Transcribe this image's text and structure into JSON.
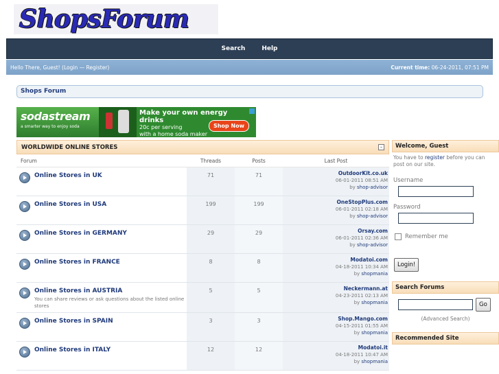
{
  "logo": {
    "text": "ShopsForum"
  },
  "nav": {
    "search": "Search",
    "help": "Help"
  },
  "welcome": {
    "greeting": "Hello There, Guest! (",
    "login": "Login",
    "sep": " — ",
    "register": "Register",
    "close": ")",
    "time_label": "Current time:",
    "time_value": " 06-24-2011, 07:51 PM"
  },
  "breadcrumb": "Shops Forum",
  "ad": {
    "brand": "sodastream",
    "tagline": "a smarter way to enjoy soda",
    "headline": "Make your own energy drinks",
    "line1": "20c per serving",
    "line2": "with a home soda maker",
    "button": "Shop Now"
  },
  "forum": {
    "section_title": "WORLDWIDE ONLINE STORES",
    "collapse": "–",
    "columns": {
      "forum": "Forum",
      "threads": "Threads",
      "posts": "Posts",
      "last_post": "Last Post"
    },
    "rows": [
      {
        "name": "Online Stores in UK",
        "desc": "",
        "threads": "71",
        "posts": "71",
        "last_title": "OutdoorKit.co.uk",
        "last_date": "06-01-2011 08:51 AM",
        "by": "by ",
        "last_user": "shop-advisor"
      },
      {
        "name": "Online Stores in USA",
        "desc": "",
        "threads": "199",
        "posts": "199",
        "last_title": "OneStopPlus.com",
        "last_date": "06-01-2011 02:18 AM",
        "by": "by ",
        "last_user": "shop-advisor"
      },
      {
        "name": "Online Stores in GERMANY",
        "desc": "",
        "threads": "29",
        "posts": "29",
        "last_title": "Orsay.com",
        "last_date": "06-01-2011 02:36 AM",
        "by": "by ",
        "last_user": "shop-advisor"
      },
      {
        "name": "Online Stores in FRANCE",
        "desc": "",
        "threads": "8",
        "posts": "8",
        "last_title": "Modatoi.com",
        "last_date": "04-18-2011 10:34 AM",
        "by": "by ",
        "last_user": "shopmania"
      },
      {
        "name": "Online Stores in AUSTRIA",
        "desc": "You can share reviews or ask questions about the listed online stores",
        "threads": "5",
        "posts": "5",
        "last_title": "Neckermann.at",
        "last_date": "04-23-2011 02:13 AM",
        "by": "by ",
        "last_user": "shopmania"
      },
      {
        "name": "Online Stores in SPAIN",
        "desc": "",
        "threads": "3",
        "posts": "3",
        "last_title": "Shop.Mango.com",
        "last_date": "04-15-2011 01:55 AM",
        "by": "by ",
        "last_user": "shopmania"
      },
      {
        "name": "Online Stores in ITALY",
        "desc": "",
        "threads": "12",
        "posts": "12",
        "last_title": "Modatoi.it",
        "last_date": "04-18-2011 10:47 AM",
        "by": "by ",
        "last_user": "shopmania"
      }
    ]
  },
  "sidebar": {
    "welcome_title": "Welcome, Guest",
    "welcome_text_1": "You have to ",
    "register_link": "register",
    "welcome_text_2": " before you can post on our site.",
    "username_label": "Username",
    "password_label": "Password",
    "remember_label": "Remember me",
    "login_button": "Login!",
    "search_title": "Search Forums",
    "go_button": "Go",
    "advanced_search": "(Advanced Search)",
    "recommended_title": "Recommended Site"
  }
}
